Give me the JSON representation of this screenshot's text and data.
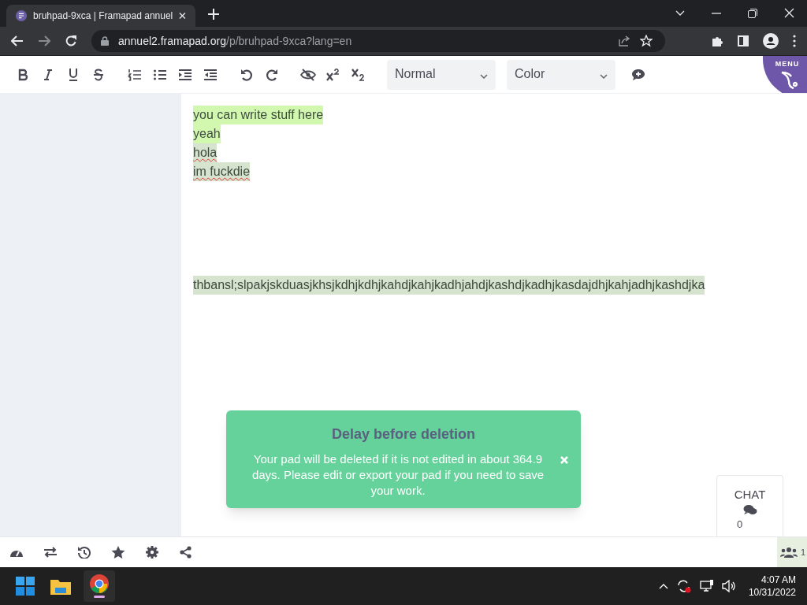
{
  "browser": {
    "tab_title": "bruhpad-9xca | Framapad annuel",
    "url_host": "annuel2.framapad.org",
    "url_path": "/p/bruhpad-9xca?lang=en"
  },
  "toolbar": {
    "buttons": [
      {
        "kind": "bold"
      },
      {
        "kind": "italic"
      },
      {
        "kind": "underline"
      },
      {
        "kind": "strike"
      },
      {
        "kind": "ol"
      },
      {
        "kind": "ul"
      },
      {
        "kind": "indent"
      },
      {
        "kind": "outdent"
      },
      {
        "kind": "undo"
      },
      {
        "kind": "redo"
      },
      {
        "kind": "eye"
      },
      {
        "kind": "sup"
      },
      {
        "kind": "sub"
      }
    ],
    "dropdowns": [
      "Normal",
      "Color"
    ],
    "menu_label": "MENU"
  },
  "document": {
    "lines": [
      {
        "text": "you can write stuff here",
        "color": "#d2f8b0",
        "spellcheck": false
      },
      {
        "text": "yeah",
        "color": "#d2f8b0",
        "spellcheck": false
      },
      {
        "text": "hola",
        "color": "#d5e3cf",
        "spellcheck": true
      },
      {
        "text": "im fuckdie",
        "color": "#d5e3cf",
        "spellcheck": true
      },
      {
        "text": "thbansl;slpakjskduasjkhsjkdhjkdhjkahdjkahjkadhjahdjkashdjkadhjkasdajdhjkahjadhjkashdjka",
        "color": "#d5e3cf",
        "spellcheck": false
      }
    ]
  },
  "notification": {
    "title": "Delay before deletion",
    "message": "Your pad will be deleted if it is not edited in about 364.9 days. Please edit or export your pad if you need to save your work."
  },
  "chat": {
    "label": "CHAT",
    "count": "0"
  },
  "users": {
    "count": "1"
  },
  "taskbar": {
    "time": "4:07 AM",
    "date": "10/31/2022"
  }
}
